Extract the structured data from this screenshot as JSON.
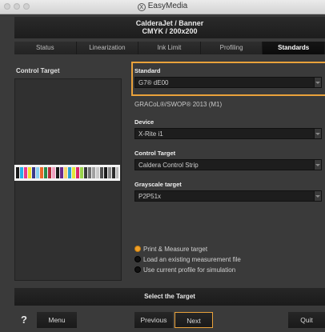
{
  "window": {
    "title": "EasyMedia",
    "logo_glyph": "X"
  },
  "header": {
    "line1": "CalderaJet / Banner",
    "line2": "CMYK / 200x200"
  },
  "tabs": [
    {
      "label": "Status",
      "active": false
    },
    {
      "label": "Linearization",
      "active": false
    },
    {
      "label": "Ink Limit",
      "active": false
    },
    {
      "label": "Profiling",
      "active": false
    },
    {
      "label": "Standards",
      "active": true
    }
  ],
  "left": {
    "label": "Control Target"
  },
  "standard": {
    "label": "Standard",
    "value": "G7® dE00",
    "subtext": "GRACoL®/SWOP® 2013 (M1)"
  },
  "device": {
    "label": "Device",
    "value": "X-Rite i1"
  },
  "control_target": {
    "label": "Control Target",
    "value": "Caldera Control Strip"
  },
  "grayscale": {
    "label": "Grayscale target",
    "value": "P2P51x"
  },
  "options": [
    {
      "label": "Print & Measure target",
      "selected": true
    },
    {
      "label": "Load an existing measurement file",
      "selected": false
    },
    {
      "label": "Use current profile for simulation",
      "selected": false
    }
  ],
  "footer": {
    "select_label": "Select the Target",
    "help": "?",
    "menu": "Menu",
    "previous": "Previous",
    "next": "Next",
    "quit": "Quit"
  },
  "colors": {
    "accent": "#e9a23b",
    "background": "#3a3a3a"
  },
  "icons": {
    "help": "question-mark-icon",
    "dropdown": "chevron-down-icon",
    "logo": "easymedia-logo-icon"
  }
}
